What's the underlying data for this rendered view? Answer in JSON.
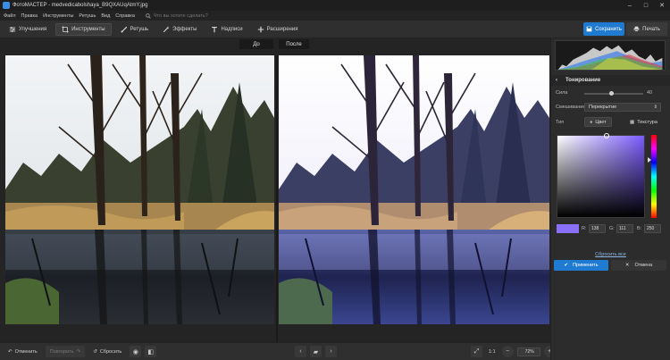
{
  "window": {
    "title": "ФотоМАСТЕР - medvedicabolshaya_B9QXAUqAtmY.jpg",
    "minimize_glyph": "–",
    "maximize_glyph": "□",
    "close_glyph": "✕"
  },
  "menu": {
    "items": [
      "Файл",
      "Правка",
      "Инструменты",
      "Ретушь",
      "Вид",
      "Справка"
    ],
    "search_placeholder": "Что вы хотите сделать?"
  },
  "toolbar": {
    "tabs": [
      {
        "label": "Улучшения",
        "icon": "sliders-icon"
      },
      {
        "label": "Инструменты",
        "icon": "crop-icon",
        "active": true
      },
      {
        "label": "Ретушь",
        "icon": "brush-icon"
      },
      {
        "label": "Эффекты",
        "icon": "magic-wand-icon"
      },
      {
        "label": "Надписи",
        "icon": "text-icon"
      },
      {
        "label": "Расширения",
        "icon": "plus-icon"
      }
    ],
    "save_label": "Сохранить",
    "print_label": "Печать"
  },
  "viewer": {
    "before_label": "До",
    "after_label": "После"
  },
  "bottom": {
    "undo_label": "Отменить",
    "redo_label": "Повторить",
    "reset_label": "Сбросить",
    "ratio_label": "1:1",
    "zoom": "72%"
  },
  "panel": {
    "section_title": "Тонирование",
    "strength_label": "Сила",
    "strength_value": "40",
    "strength_fraction": 0.4,
    "blend_label": "Смешивание",
    "blend_value": "Перекрытие",
    "type_label": "Тип",
    "type_color": "Цвет",
    "type_texture": "Текстура",
    "rgb": {
      "r_label": "R:",
      "r": "138",
      "g_label": "G:",
      "g": "111",
      "b_label": "B:",
      "b": "250"
    },
    "swatch_color": "#8a6ffa",
    "reset_all": "Сбросить все",
    "apply_label": "Применить",
    "cancel_label": "Отмена"
  },
  "colors": {
    "accent": "#1f7ad1",
    "panel_bg": "#2c2c2c"
  }
}
